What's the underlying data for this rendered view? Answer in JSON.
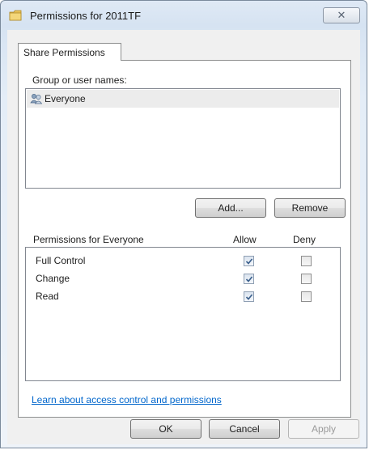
{
  "window": {
    "title": "Permissions for 2011TF",
    "close_glyph": "✕"
  },
  "tabs": [
    {
      "label": "Share Permissions",
      "active": true
    }
  ],
  "group_section": {
    "label": "Group or user names:",
    "items": [
      {
        "name": "Everyone",
        "icon": "users-icon",
        "selected": true
      }
    ],
    "add_button": "Add...",
    "remove_button": "Remove"
  },
  "permissions": {
    "header": "Permissions for Everyone",
    "allow_header": "Allow",
    "deny_header": "Deny",
    "rows": [
      {
        "name": "Full Control",
        "allow": true,
        "deny": false
      },
      {
        "name": "Change",
        "allow": true,
        "deny": false
      },
      {
        "name": "Read",
        "allow": true,
        "deny": false
      }
    ]
  },
  "help_link": "Learn about access control and permissions",
  "footer": {
    "ok": "OK",
    "cancel": "Cancel",
    "apply": "Apply",
    "apply_enabled": false
  },
  "colors": {
    "link": "#0066cc",
    "selection": "#ececec",
    "title_bar": "#dfe9f5"
  }
}
